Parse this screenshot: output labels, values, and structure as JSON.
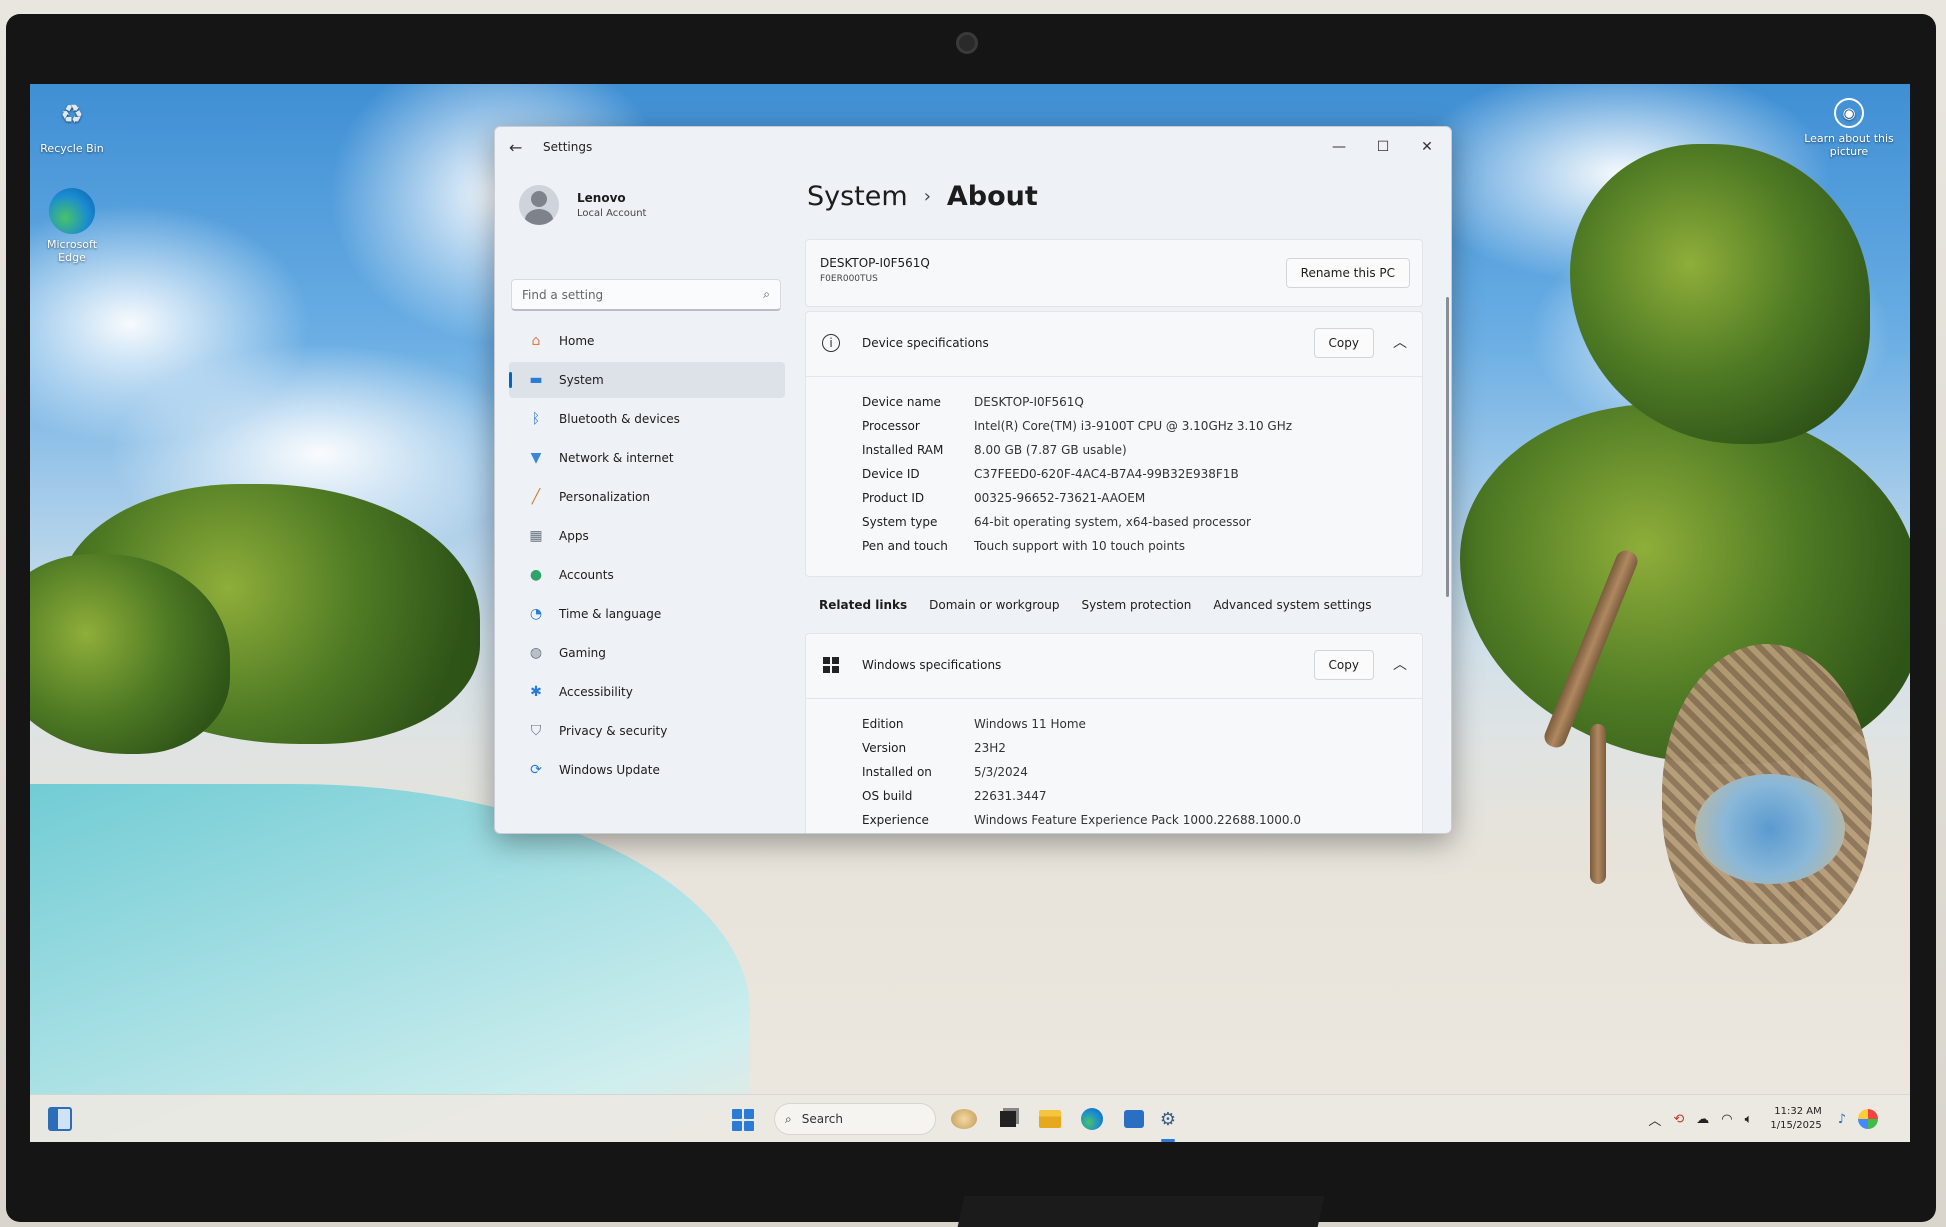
{
  "desktop": {
    "icons": [
      {
        "label": "Recycle Bin"
      },
      {
        "label": "Microsoft Edge"
      }
    ],
    "learn_label": "Learn about this picture"
  },
  "window": {
    "title": "Settings",
    "controls": {
      "minimize": "—",
      "maximize": "☐",
      "close": "✕"
    }
  },
  "profile": {
    "name": "Lenovo",
    "subtitle": "Local Account"
  },
  "search": {
    "placeholder": "Find a setting"
  },
  "nav": [
    {
      "label": "Home",
      "icon": "home-icon",
      "color": "#e07a4a"
    },
    {
      "label": "System",
      "icon": "system-icon",
      "color": "#2a7bd6"
    },
    {
      "label": "Bluetooth & devices",
      "icon": "bluetooth-icon",
      "color": "#2a7bd6"
    },
    {
      "label": "Network & internet",
      "icon": "wifi-icon",
      "color": "#3a86d8"
    },
    {
      "label": "Personalization",
      "icon": "brush-icon",
      "color": "#d0802f"
    },
    {
      "label": "Apps",
      "icon": "apps-icon",
      "color": "#6a7480"
    },
    {
      "label": "Accounts",
      "icon": "account-icon",
      "color": "#2fa36a"
    },
    {
      "label": "Time & language",
      "icon": "globe-icon",
      "color": "#2a7bd6"
    },
    {
      "label": "Gaming",
      "icon": "gamepad-icon",
      "color": "#6a7480"
    },
    {
      "label": "Accessibility",
      "icon": "accessibility-icon",
      "color": "#2a7bd6"
    },
    {
      "label": "Privacy & security",
      "icon": "shield-icon",
      "color": "#6a7480"
    },
    {
      "label": "Windows Update",
      "icon": "update-icon",
      "color": "#2a7bd6"
    }
  ],
  "breadcrumb": {
    "parent": "System",
    "separator": "›",
    "current": "About"
  },
  "pc": {
    "name": "DESKTOP-I0F561Q",
    "model": "F0ER000TUS",
    "rename_label": "Rename this PC"
  },
  "device_specs": {
    "title": "Device specifications",
    "copy_label": "Copy",
    "rows": [
      {
        "label": "Device name",
        "value": "DESKTOP-I0F561Q"
      },
      {
        "label": "Processor",
        "value": "Intel(R) Core(TM) i3-9100T CPU @ 3.10GHz   3.10 GHz"
      },
      {
        "label": "Installed RAM",
        "value": "8.00 GB (7.87 GB usable)"
      },
      {
        "label": "Device ID",
        "value": "C37FEED0-620F-4AC4-B7A4-99B32E938F1B"
      },
      {
        "label": "Product ID",
        "value": "00325-96652-73621-AAOEM"
      },
      {
        "label": "System type",
        "value": "64-bit operating system, x64-based processor"
      },
      {
        "label": "Pen and touch",
        "value": "Touch support with 10 touch points"
      }
    ]
  },
  "related": {
    "title": "Related links",
    "links": [
      "Domain or workgroup",
      "System protection",
      "Advanced system settings"
    ]
  },
  "windows_specs": {
    "title": "Windows specifications",
    "copy_label": "Copy",
    "rows": [
      {
        "label": "Edition",
        "value": "Windows 11 Home"
      },
      {
        "label": "Version",
        "value": "23H2"
      },
      {
        "label": "Installed on",
        "value": "5/3/2024"
      },
      {
        "label": "OS build",
        "value": "22631.3447"
      },
      {
        "label": "Experience",
        "value": "Windows Feature Experience Pack 1000.22688.1000.0"
      }
    ]
  },
  "taskbar": {
    "search_label": "Search",
    "time": "11:32 AM",
    "date": "1/15/2025"
  }
}
